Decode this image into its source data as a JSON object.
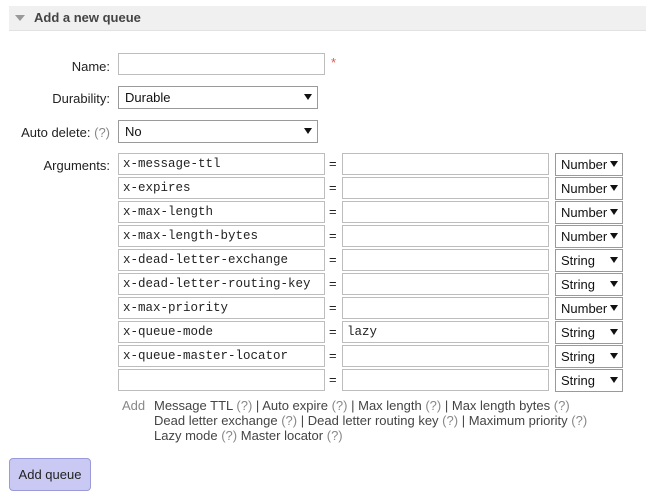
{
  "section": {
    "title": "Add a new queue"
  },
  "form": {
    "name_label": "Name:",
    "name_value": "",
    "required_marker": "*",
    "durability_label": "Durability:",
    "durability_value": "Durable",
    "auto_delete_label": "Auto delete:",
    "auto_delete_help": "(?)",
    "auto_delete_value": "No",
    "arguments_label": "Arguments:"
  },
  "arguments": [
    {
      "key": "x-message-ttl",
      "value": "",
      "type": "Number"
    },
    {
      "key": "x-expires",
      "value": "",
      "type": "Number"
    },
    {
      "key": "x-max-length",
      "value": "",
      "type": "Number"
    },
    {
      "key": "x-max-length-bytes",
      "value": "",
      "type": "Number"
    },
    {
      "key": "x-dead-letter-exchange",
      "value": "",
      "type": "String"
    },
    {
      "key": "x-dead-letter-routing-key",
      "value": "",
      "type": "String"
    },
    {
      "key": "x-max-priority",
      "value": "",
      "type": "Number"
    },
    {
      "key": "x-queue-mode",
      "value": "lazy",
      "type": "String"
    },
    {
      "key": "x-queue-master-locator",
      "value": "",
      "type": "String"
    },
    {
      "key": "",
      "value": "",
      "type": "String"
    }
  ],
  "equals_sign": "=",
  "add_section": {
    "label": "Add",
    "help": "(?)",
    "separator": "|",
    "links": [
      "Message TTL",
      "Auto expire",
      "Max length",
      "Max length bytes",
      "Dead letter exchange",
      "Dead letter routing key",
      "Maximum priority",
      "Lazy mode",
      "Master locator"
    ]
  },
  "submit_button": "Add queue"
}
